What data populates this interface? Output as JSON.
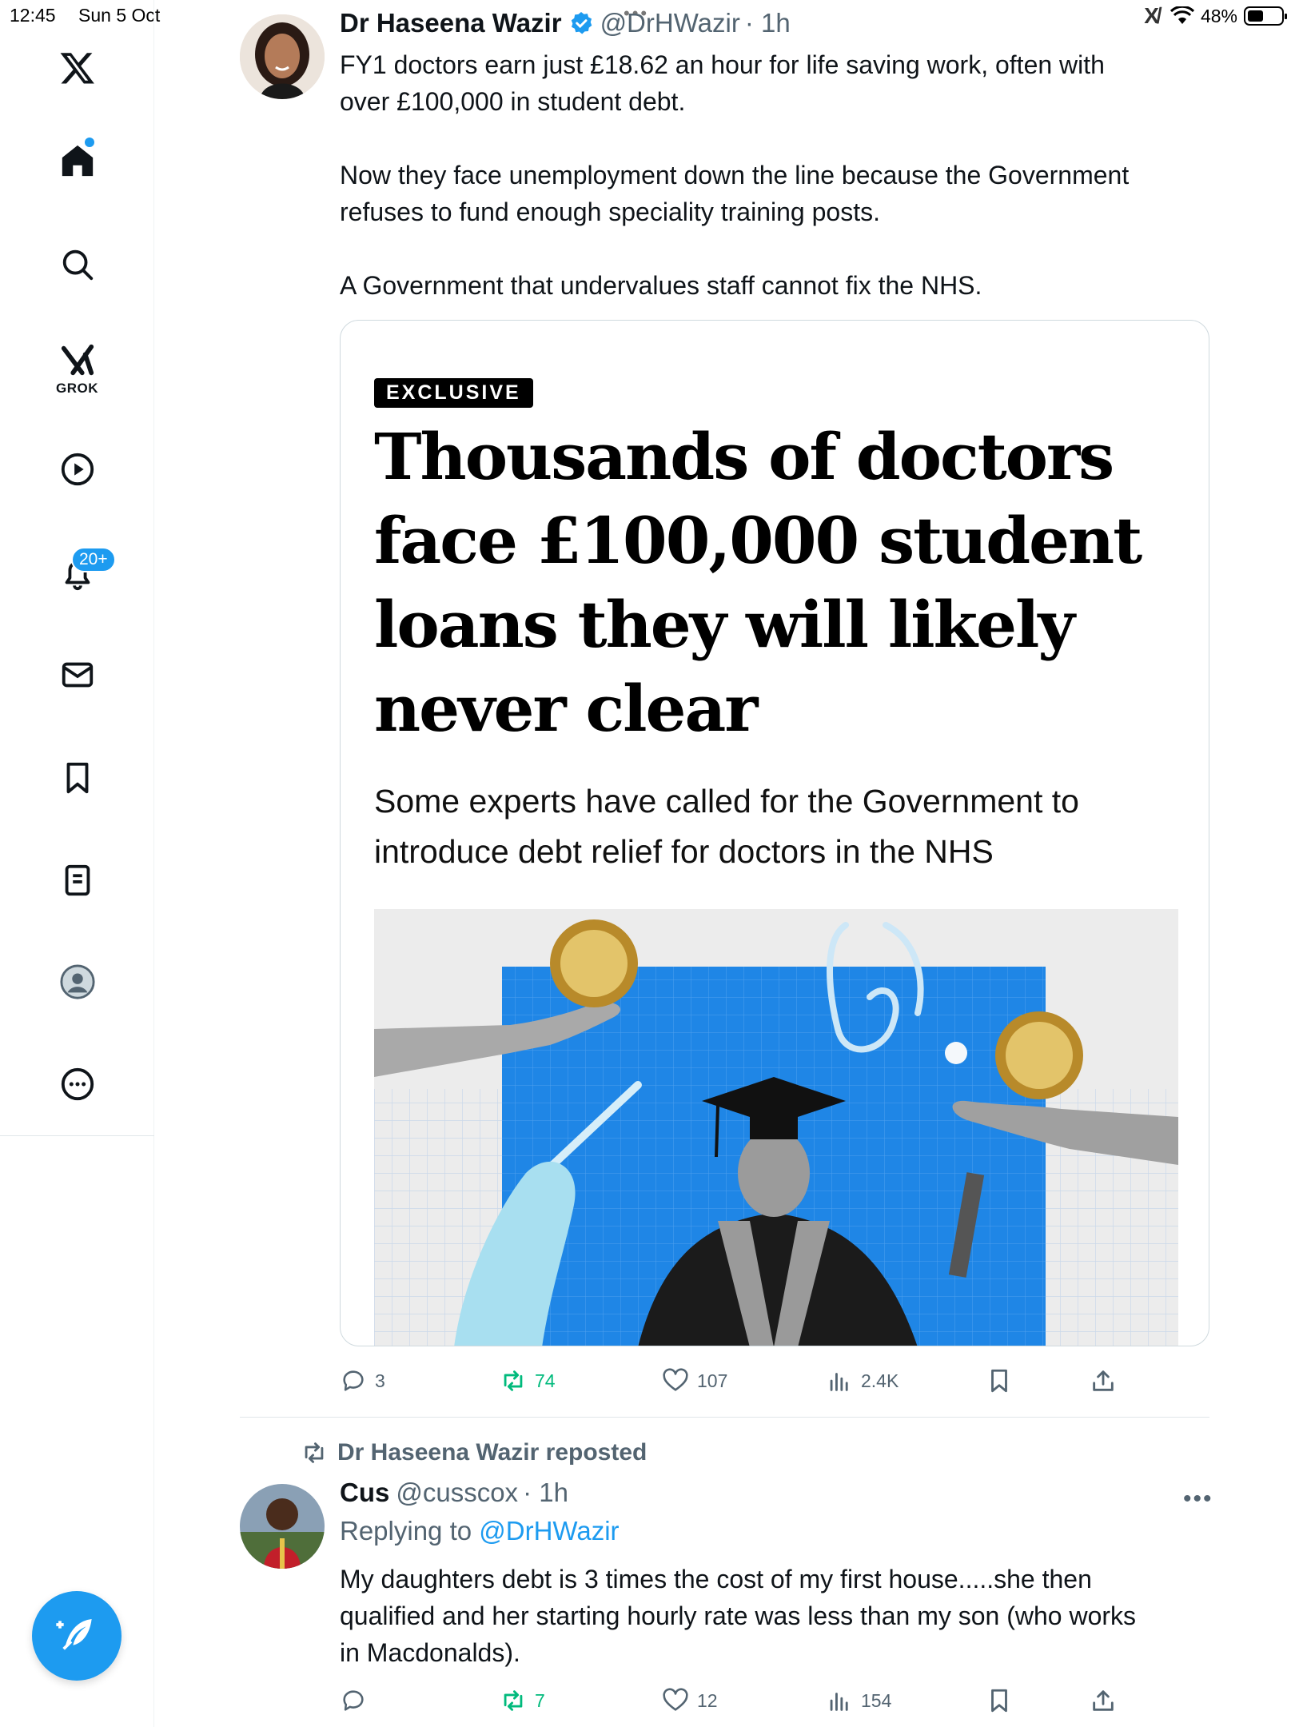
{
  "status_bar": {
    "time": "12:45",
    "date": "Sun 5 Oct",
    "battery": "48%",
    "battery_level": 0.48
  },
  "sidebar": {
    "items": [
      {
        "name": "x-logo"
      },
      {
        "name": "home",
        "active": true
      },
      {
        "name": "search"
      },
      {
        "name": "grok",
        "label": "GROK"
      },
      {
        "name": "video"
      },
      {
        "name": "notifications",
        "badge": "20+"
      },
      {
        "name": "messages"
      },
      {
        "name": "bookmarks"
      },
      {
        "name": "lists"
      },
      {
        "name": "profile"
      },
      {
        "name": "more"
      }
    ]
  },
  "tweets": [
    {
      "display_name": "Dr Haseena Wazir",
      "verified": true,
      "handle": "@DrHWazir",
      "time": "· 1h",
      "text": "FY1 doctors earn just £18.62 an hour for life saving work, often with\nover £100,000 in student debt.\n\nNow they face unemployment down the line because the Government\nrefuses to fund enough speciality training posts.\n\nA Government that undervalues staff cannot fix the NHS.",
      "card": {
        "label": "EXCLUSIVE",
        "headline": "Thousands of doctors face £100,000 student loans they will likely never clear",
        "subhead": "Some experts have called for the Government to introduce debt relief for doctors in the NHS"
      },
      "actions": {
        "replies": "3",
        "reposts": "74",
        "likes": "107",
        "views": "2.4K"
      }
    },
    {
      "repost_by": "Dr Haseena Wazir reposted",
      "display_name": "Cus",
      "handle": "@cusscox",
      "time": "· 1h",
      "replying_prefix": "Replying to ",
      "replying_to": "@DrHWazir",
      "text": "My daughters debt is 3 times the cost of my first house.....she then\nqualified and her starting hourly rate was less than my son (who works\nin Macdonalds).",
      "actions": {
        "replies": "",
        "reposts": "7",
        "likes": "12",
        "views": "154"
      }
    }
  ],
  "colors": {
    "accent": "#1d9bf0",
    "retweet": "#00ba7c",
    "muted": "#536471"
  }
}
